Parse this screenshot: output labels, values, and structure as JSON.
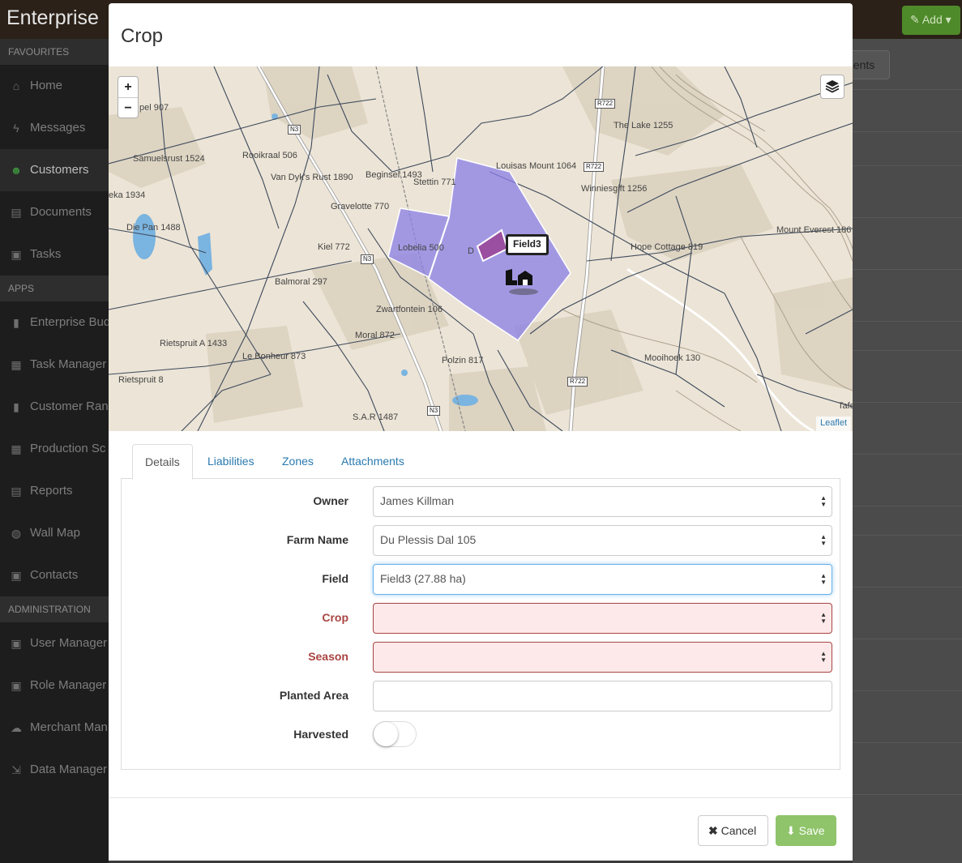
{
  "app": {
    "brand": "Enterprise",
    "add_button": "✎ Add ▾",
    "ghost_button": "nents"
  },
  "sidebar": {
    "sections": [
      {
        "header": "FAVOURITES",
        "items": [
          {
            "label": "Home",
            "icon": "home-icon",
            "glyph": "⌂"
          },
          {
            "label": "Messages",
            "icon": "bolt-icon",
            "glyph": "ϟ"
          },
          {
            "label": "Customers",
            "icon": "users-icon",
            "glyph": "☻",
            "active": true
          },
          {
            "label": "Documents",
            "icon": "document-icon",
            "glyph": "▤"
          },
          {
            "label": "Tasks",
            "icon": "briefcase-icon",
            "glyph": "▣"
          }
        ]
      },
      {
        "header": "APPS",
        "items": [
          {
            "label": "Enterprise Bud",
            "icon": "bar-chart-icon",
            "glyph": "▮"
          },
          {
            "label": "Task Manager",
            "icon": "calendar-icon",
            "glyph": "▦"
          },
          {
            "label": "Customer Ran",
            "icon": "bar-chart-icon",
            "glyph": "▮"
          },
          {
            "label": "Production Sc",
            "icon": "calendar-icon",
            "glyph": "▦"
          },
          {
            "label": "Reports",
            "icon": "document-icon",
            "glyph": "▤"
          },
          {
            "label": "Wall Map",
            "icon": "globe-icon",
            "glyph": "◍"
          },
          {
            "label": "Contacts",
            "icon": "contact-icon",
            "glyph": "▣"
          }
        ]
      },
      {
        "header": "ADMINISTRATION",
        "items": [
          {
            "label": "User Manager",
            "icon": "id-card-icon",
            "glyph": "▣"
          },
          {
            "label": "Role Manager",
            "icon": "id-card-icon",
            "glyph": "▣"
          },
          {
            "label": "Merchant Man",
            "icon": "cloud-icon",
            "glyph": "☁"
          },
          {
            "label": "Data Manager",
            "icon": "import-icon",
            "glyph": "⇲"
          }
        ]
      }
    ]
  },
  "modal": {
    "title": "Crop",
    "map": {
      "zoom_in": "+",
      "zoom_out": "−",
      "attribution": "Leaflet",
      "selected_field_tooltip": "Field3",
      "place_labels": [
        "Samuelsrust 1524",
        "Rooikraal 506",
        "Van Dyk's Rust 1890",
        "Beginsel 1493",
        "Stettin 771",
        "Louisas Mount 1064",
        "The Lake 1255",
        "Winniesgift 1256",
        "Gravelotte 770",
        "Lobelia 500",
        "Die Pan 1488",
        "Kiel 772",
        "Balmoral 297",
        "Zwartfontein 106",
        "Moral 872",
        "Hope Cottage 819",
        "Mount Everest 186",
        "Rietspruit A 1433",
        "Le Bonheur 873",
        "Polzin 817",
        "Mooihoek 130",
        "Rietspruit 8",
        "S.A.R 1487",
        "pel 907",
        "eka 1934",
        "D",
        "Tafe"
      ],
      "road_labels": [
        "N3",
        "N3",
        "N3",
        "R722",
        "R722",
        "R722"
      ]
    },
    "tabs": [
      {
        "label": "Details",
        "active": true
      },
      {
        "label": "Liabilities"
      },
      {
        "label": "Zones"
      },
      {
        "label": "Attachments"
      }
    ],
    "form": {
      "owner": {
        "label": "Owner",
        "value": "James Killman"
      },
      "farm_name": {
        "label": "Farm Name",
        "value": "Du Plessis Dal 105"
      },
      "field": {
        "label": "Field",
        "value": "Field3 (27.88 ha)"
      },
      "crop": {
        "label": "Crop",
        "value": ""
      },
      "season": {
        "label": "Season",
        "value": ""
      },
      "planted_area": {
        "label": "Planted Area",
        "value": ""
      },
      "harvested": {
        "label": "Harvested",
        "value": false
      }
    },
    "footer": {
      "cancel": "Cancel",
      "save": "Save"
    }
  },
  "colors": {
    "farm_polygon": "#8a7fe6",
    "field_polygon": "#9b4fa0",
    "error": "#a94442",
    "save_button": "#8fc46a",
    "link": "#2a7ab0"
  }
}
